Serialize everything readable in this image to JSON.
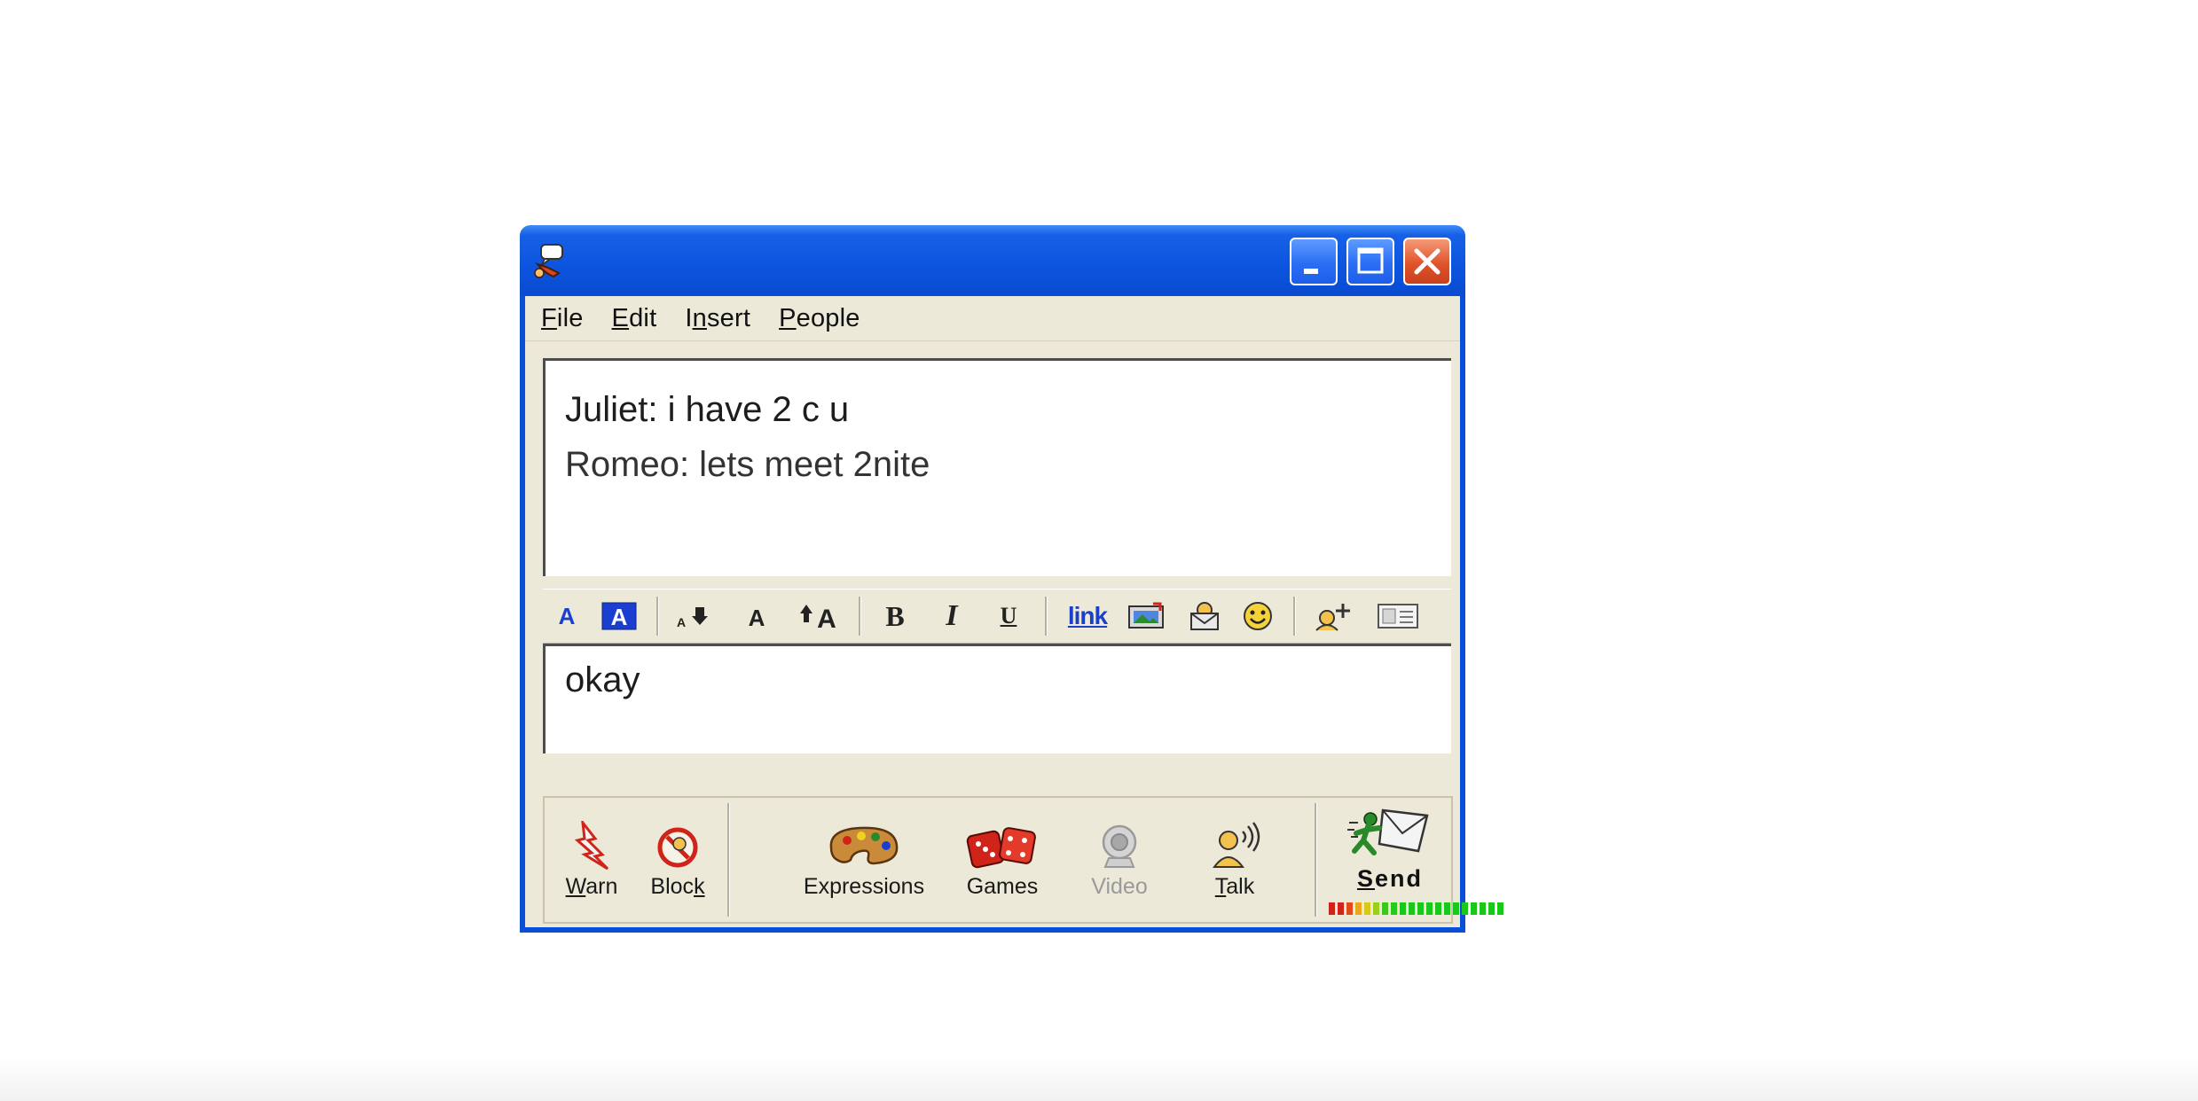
{
  "window": {
    "title": "",
    "controls": {
      "minimize_icon": "minimize-icon",
      "maximize_icon": "maximize-icon",
      "close_icon": "close-icon"
    }
  },
  "menu": {
    "items": [
      {
        "accel": "F",
        "rest": "ile"
      },
      {
        "accel": "E",
        "rest": "dit"
      },
      {
        "pre": "I",
        "accel": "n",
        "rest": "sert"
      },
      {
        "accel": "P",
        "rest": "eople"
      }
    ]
  },
  "conversation": {
    "messages": [
      "Juliet: i have 2 c u",
      "Romeo: lets meet 2nite"
    ]
  },
  "compose": {
    "text": "okay"
  },
  "toolbar": {
    "link_label": "link",
    "bold_glyph": "B",
    "italic_glyph": "I",
    "underline_glyph": "U"
  },
  "actions": {
    "warn": {
      "accel": "W",
      "rest": "arn"
    },
    "block": {
      "pre": "Bloc",
      "accel": "k",
      "rest": ""
    },
    "expressions": "Expressions",
    "games": "Games",
    "video": "Video",
    "talk": {
      "accel": "T",
      "rest": "alk"
    },
    "send": {
      "accel": "S",
      "rest": "end"
    }
  },
  "colors": {
    "titlebar": "#0c54de",
    "face": "#ece9d8",
    "close": "#e1532a",
    "link": "#1a40c8"
  }
}
